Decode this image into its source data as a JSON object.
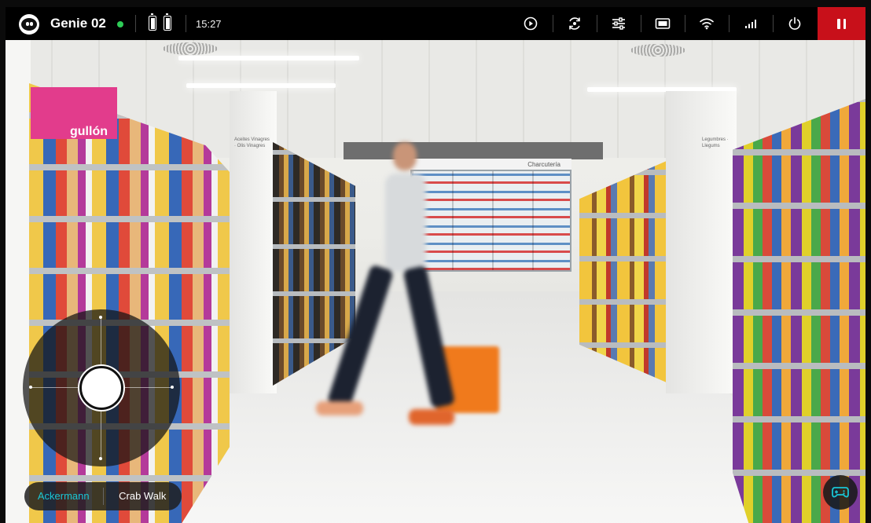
{
  "app": {
    "device_name": "Genie 02",
    "connection_status_color": "#2ecc57",
    "time": "15:27",
    "battery_count": 2
  },
  "toolbar": {
    "icons": [
      "play-circle-icon",
      "camera-switch-icon",
      "sliders-icon",
      "display-icon",
      "wifi-icon",
      "signal-icon",
      "power-icon"
    ],
    "pause_color": "#c8101a"
  },
  "scene": {
    "brand_sign": "gullón",
    "fridge_sign": "Charcutería",
    "left_pillar_sign": "Aceites Vinagres · Olis Vinagres",
    "right_pillar_sign": "Legumbres · Llegums"
  },
  "controls": {
    "modes": [
      {
        "label": "Ackermann",
        "active": true
      },
      {
        "label": "Crab Walk",
        "active": false
      }
    ],
    "accent_color": "#19c6d6"
  }
}
